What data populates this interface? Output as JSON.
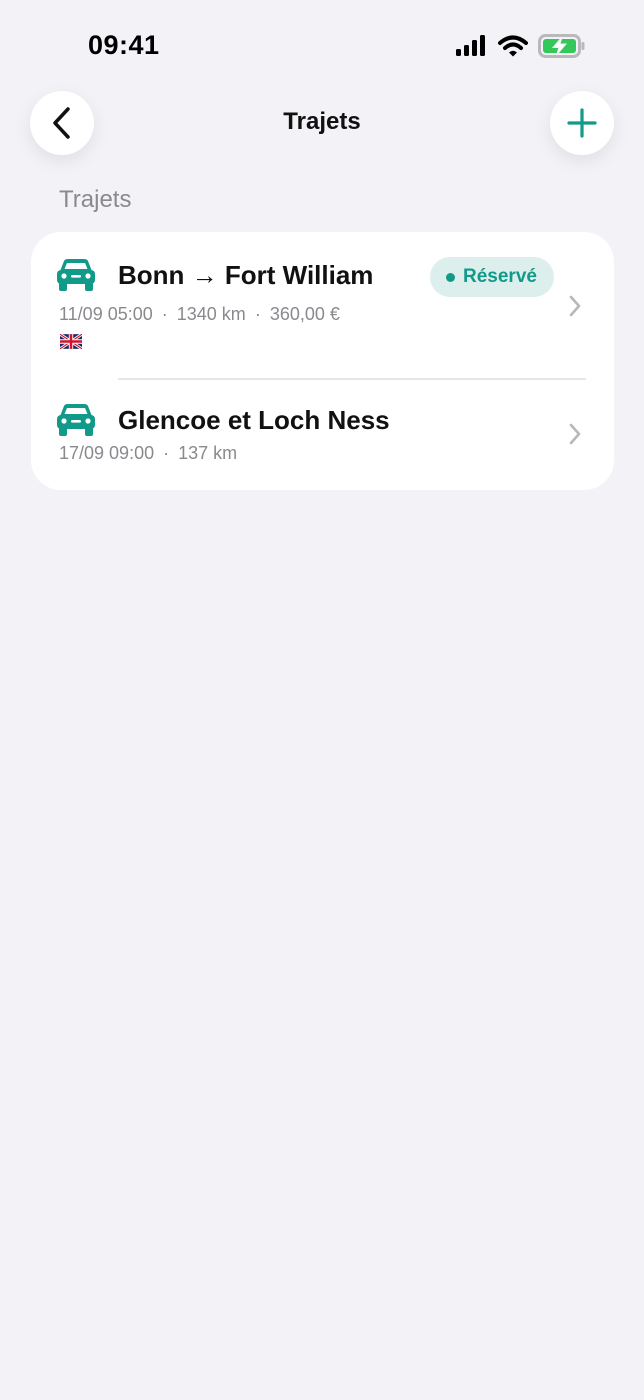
{
  "status_bar": {
    "time": "09:41",
    "icons": [
      "cellular-signal-icon",
      "wifi-icon",
      "battery-charging-icon"
    ]
  },
  "nav": {
    "title": "Trajets",
    "back_icon": "chevron-left-icon",
    "add_icon": "plus-icon"
  },
  "section": {
    "header": "Trajets"
  },
  "trips": [
    {
      "title": "Bonn → Fort William",
      "date": "11/09 05:00",
      "distance": "1340 km",
      "price": "360,00 €",
      "flag": "uk-flag-icon",
      "status": "Réservé",
      "icon": "car-icon"
    },
    {
      "title": "Glencoe et Loch Ness",
      "date": "17/09 09:00",
      "distance": "137 km",
      "icon": "car-icon"
    }
  ],
  "colors": {
    "accent": "#119a8a",
    "background": "#f2f2f7",
    "badge_background": "#ddefec",
    "secondary_text": "#8a8a8e"
  }
}
